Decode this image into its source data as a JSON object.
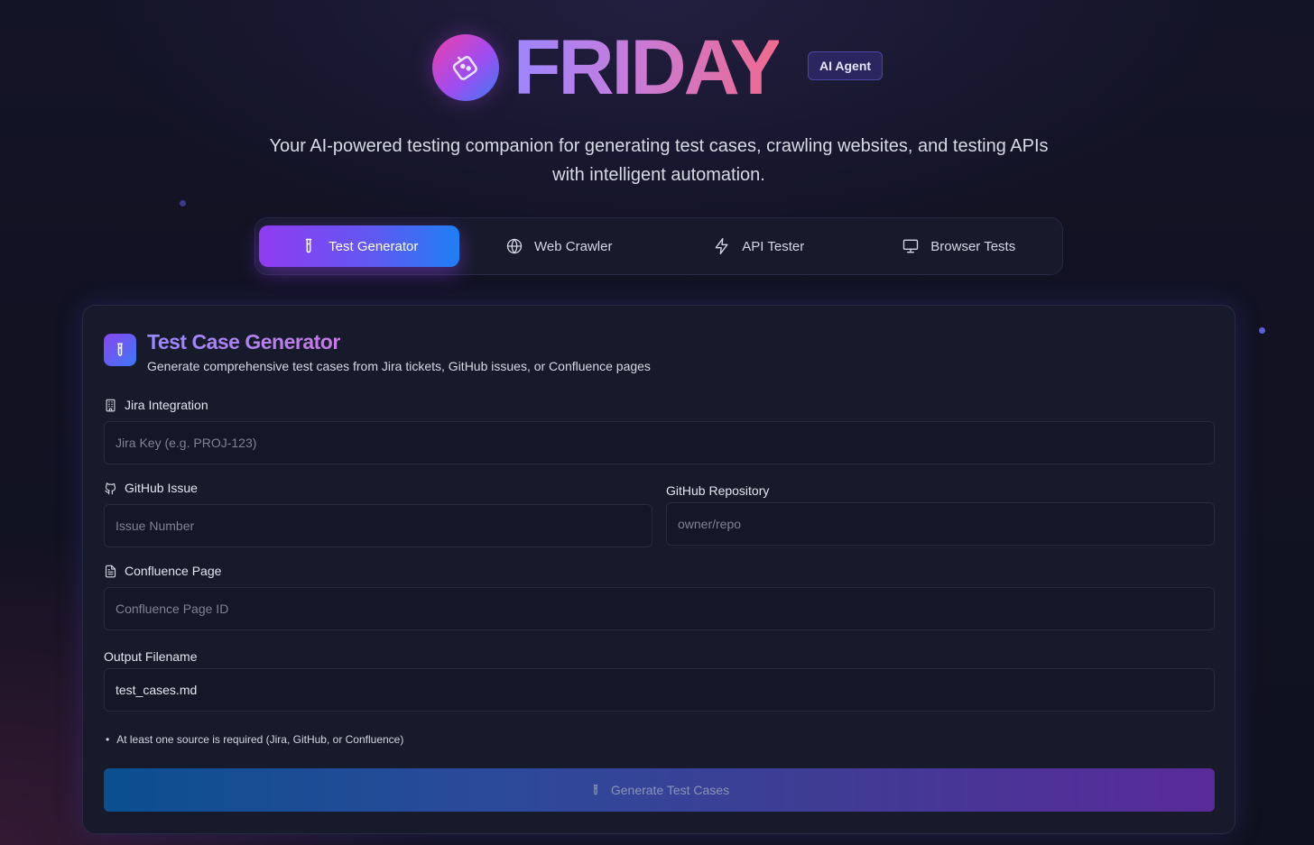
{
  "app": {
    "title": "FRIDAY",
    "badge": "AI Agent",
    "subtitle": "Your AI-powered testing companion for generating test cases, crawling websites, and testing APIs with intelligent automation."
  },
  "tabs": [
    {
      "label": "Test Generator",
      "icon": "test-tube-icon",
      "active": true
    },
    {
      "label": "Web Crawler",
      "icon": "globe-icon",
      "active": false
    },
    {
      "label": "API Tester",
      "icon": "lightning-icon",
      "active": false
    },
    {
      "label": "Browser Tests",
      "icon": "monitor-icon",
      "active": false
    }
  ],
  "card": {
    "title": "Test Case Generator",
    "description": "Generate comprehensive test cases from Jira tickets, GitHub issues, or Confluence pages",
    "jira": {
      "label": "Jira Integration",
      "placeholder": "Jira Key (e.g. PROJ-123)"
    },
    "github_issue": {
      "label": "GitHub Issue",
      "placeholder": "Issue Number"
    },
    "github_repo": {
      "label": "GitHub Repository",
      "placeholder": "owner/repo"
    },
    "confluence": {
      "label": "Confluence Page",
      "placeholder": "Confluence Page ID"
    },
    "output": {
      "label": "Output Filename",
      "value": "test_cases.md"
    },
    "note": "At least one source is required (Jira, GitHub, or Confluence)",
    "button": "Generate Test Cases"
  },
  "colors": {
    "accent_purple": "#8f3cf0",
    "accent_blue": "#1f7ff5",
    "background": "#131426"
  }
}
